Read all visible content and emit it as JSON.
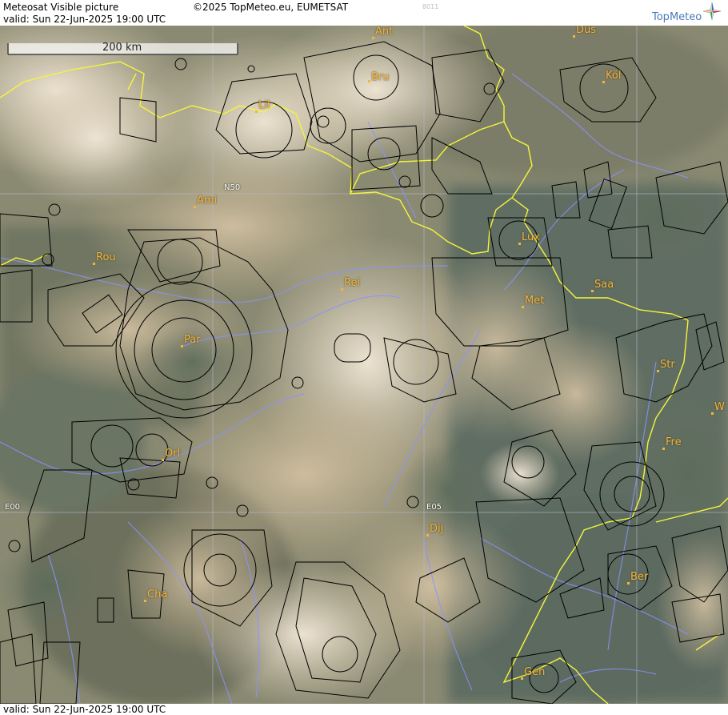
{
  "header": {
    "title": "Meteosat Visible picture",
    "copyright": "©2025 TopMeteo.eu, EUMETSAT",
    "valid": "valid:  Sun  22-Jun-2025  19:00 UTC",
    "code": "8011",
    "logo": "TopMeteo"
  },
  "scale": {
    "label": "200 km"
  },
  "grid_labels": {
    "n50": "N50",
    "e00": "E00",
    "e05": "E05"
  },
  "cities": {
    "ant": "Ant",
    "dus": "Düs",
    "bru": "Bru",
    "kol": "Köl",
    "lil": "Lil",
    "ami": "Ami",
    "rou": "Rou",
    "lux": "Lux",
    "rei": "Rei",
    "saa": "Saa",
    "met": "Met",
    "par": "Par",
    "str": "Str",
    "w": "W",
    "fre": "Fre",
    "orl": "Orl",
    "dij": "Dij",
    "ber": "Ber",
    "cha": "Cha",
    "gen": "Gen"
  },
  "footer": {
    "valid": "valid:  Sun  22-Jun-2025  19:00 UTC"
  },
  "colors": {
    "border": "#f5f53a",
    "rivers": "#8a92ff",
    "airspace": "#000000",
    "city": "#f2b63a"
  }
}
